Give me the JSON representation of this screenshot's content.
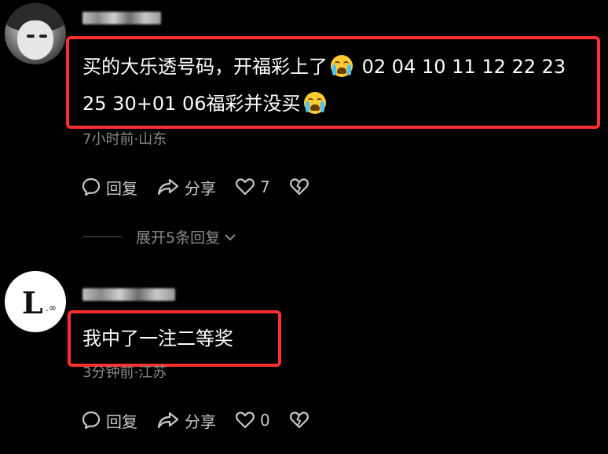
{
  "comments": [
    {
      "text_line1": "买的大乐透号码，开福彩上了",
      "numbers_line1": "02 04 10 11 12 22 23",
      "text_line2_prefix": "25 30+01 06福彩并没买",
      "meta": "7小时前·山东",
      "reply_label": "回复",
      "share_label": "分享",
      "like_count": "7",
      "expand_label": "展开5条回复"
    },
    {
      "text": "我中了一注二等奖",
      "meta": "3分钟前·江苏",
      "reply_label": "回复",
      "share_label": "分享",
      "like_count": "0"
    }
  ],
  "colors": {
    "background": "#000000",
    "highlight": "#ff2f2f",
    "meta": "#8a8a8a",
    "action": "#c8c8c8"
  },
  "icons": [
    "reply-bubble-icon",
    "share-arrow-icon",
    "heart-icon",
    "broken-heart-icon",
    "chevron-down-icon",
    "crying-emoji-icon"
  ]
}
